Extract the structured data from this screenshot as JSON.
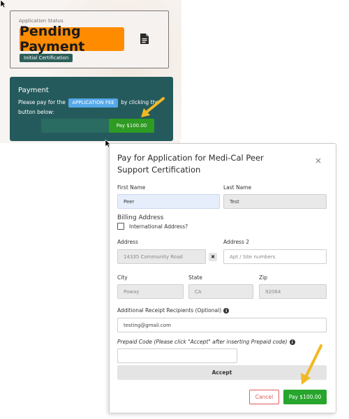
{
  "status_card": {
    "label": "Application Status",
    "status": "Pending Payment",
    "badge": "Initial Certification"
  },
  "payment_card": {
    "title": "Payment",
    "text_before": "Please pay for the",
    "fee_badge": "APPLICATION FEE",
    "text_after": "by clicking the button below:",
    "pay_button": "Pay $100.00"
  },
  "modal": {
    "title": "Pay for Application for Medi-Cal Peer Support Certification",
    "close": "×",
    "first_name": {
      "label": "First Name",
      "value": "Peer"
    },
    "last_name": {
      "label": "Last Name",
      "value": "Test"
    },
    "billing_heading": "Billing Address",
    "international_label": "International Address?",
    "address": {
      "label": "Address",
      "value": "14335 Community Road"
    },
    "address2": {
      "label": "Address 2",
      "placeholder": "Apt / Site numbers"
    },
    "clear_x": "✖",
    "city": {
      "label": "City",
      "value": "Poway"
    },
    "state": {
      "label": "State",
      "value": "CA"
    },
    "zip": {
      "label": "Zip",
      "value": "92064"
    },
    "recipients": {
      "label": "Additional Receipt Recipients (Optional)",
      "value": "testing@gmail.com"
    },
    "prepaid": {
      "label": "Prepaid Code (Please click \"Accept\" after inserting Prepaid code)",
      "value": ""
    },
    "info_glyph": "i",
    "accept_button": "Accept",
    "cancel_button": "Cancel",
    "pay_button": "Pay $100.00"
  },
  "colors": {
    "pending_orange": "#ff8c00",
    "teal": "#255a5c",
    "pay_green": "#27a52c",
    "fee_blue": "#55a8ea",
    "cancel_red": "#e05a5a",
    "arrow_yellow": "#f2b822"
  }
}
